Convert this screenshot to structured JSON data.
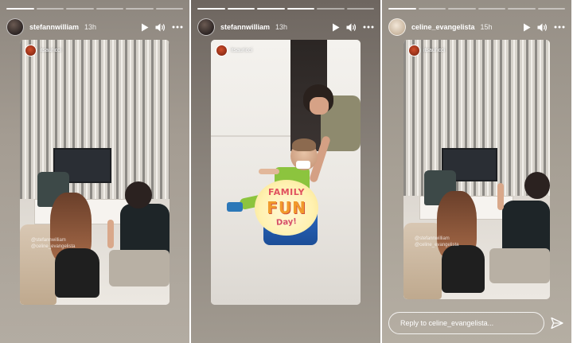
{
  "stories": [
    {
      "username": "stefannwilliam",
      "age": "13h",
      "progress": {
        "segments": 6,
        "active": 1
      },
      "tag": "itsauricci",
      "mentions": [
        "@stefannwilliam",
        "@celine_evangelista"
      ]
    },
    {
      "username": "stefannwilliam",
      "age": "13h",
      "progress": {
        "segments": 6,
        "active": 4
      },
      "tag": "itsauricci",
      "sticker": {
        "line1": "FAMILY",
        "line2": "FUN",
        "line3": "Day!"
      }
    },
    {
      "username": "celine_evangelista",
      "age": "15h",
      "progress": {
        "segments": 6,
        "active": 1
      },
      "tag": "itsauricci",
      "mentions": [
        "@stefannwilliam",
        "@celine_evangelista"
      ],
      "reply_placeholder": "Reply to celine_evangelista..."
    }
  ],
  "icons": {
    "play": "play-icon",
    "sound": "speaker-icon",
    "more": "more-dots-icon",
    "send": "send-icon"
  },
  "colors": {
    "sticker_red": "#e0515f",
    "sticker_orange": "#f19a2c",
    "kid_shirt": "#8cc43e",
    "toy_blue": "#2c6cc7"
  }
}
